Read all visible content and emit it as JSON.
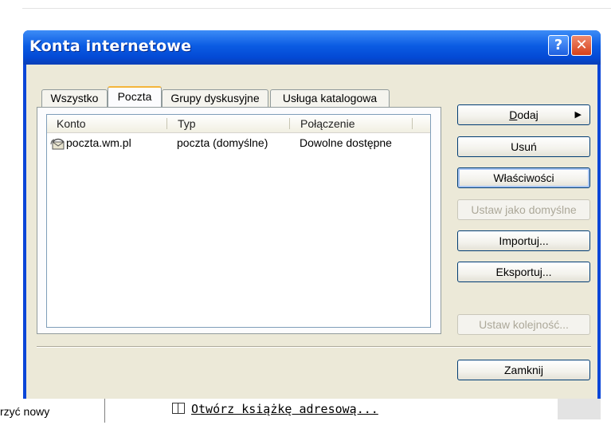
{
  "window": {
    "title": "Konta internetowe",
    "help_label": "?",
    "close_label": "✕"
  },
  "tabs": [
    {
      "label": "Wszystko",
      "active": false
    },
    {
      "label": "Poczta",
      "active": true
    },
    {
      "label": "Grupy dyskusyjne",
      "active": false
    },
    {
      "label": "Usługa katalogowa",
      "active": false
    }
  ],
  "list": {
    "columns": [
      "Konto",
      "Typ",
      "Połączenie"
    ],
    "rows": [
      {
        "account": "poczta.wm.pl",
        "type": "poczta (domyślne)",
        "connection": "Dowolne dostępne",
        "icon": "mail-account-icon"
      }
    ]
  },
  "buttons": {
    "dodaj": {
      "prefix": "",
      "mnemonic": "D",
      "rest": "odaj",
      "arrow": "▶"
    },
    "usun": "Usuń",
    "wlasciwosci": "Właściwości",
    "ustaw_domyslne": "Ustaw jako domyślne",
    "importuj": "Importuj...",
    "eksportuj": "Eksportuj...",
    "ustaw_kolejnosc": "Ustaw kolejność...",
    "zamknij": "Zamknij"
  },
  "background": {
    "partial_text": "rzyć nowy",
    "link_text": "Otwórz książkę adresową..."
  }
}
